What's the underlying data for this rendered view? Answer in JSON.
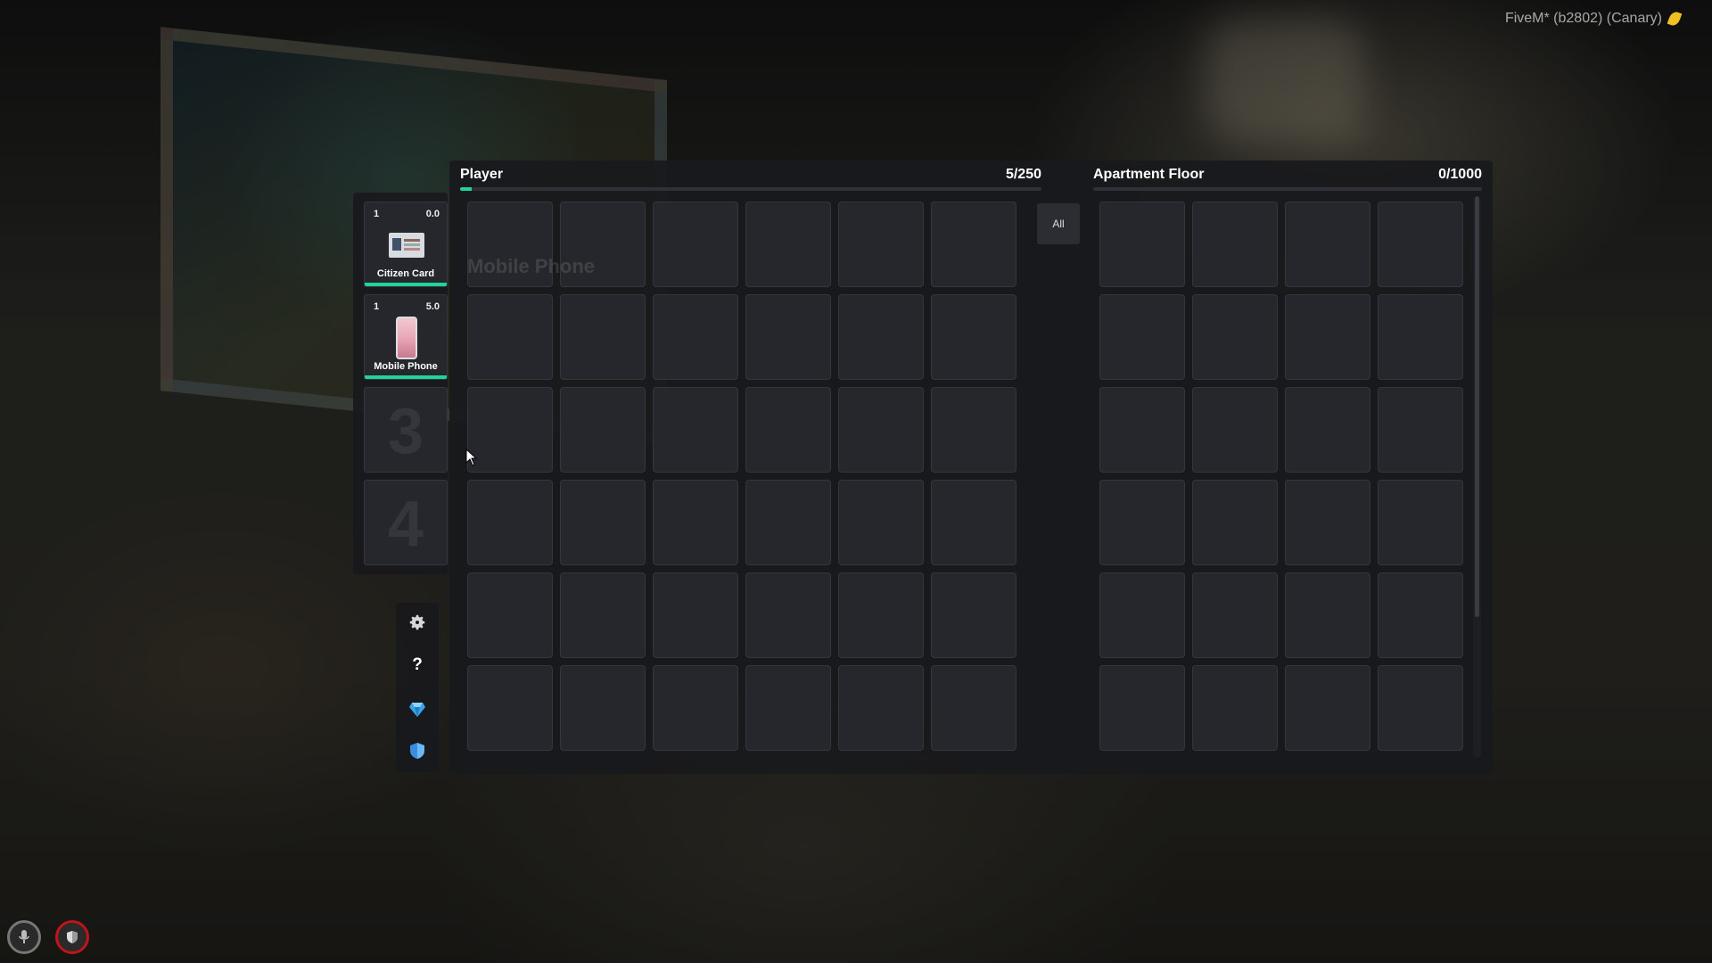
{
  "watermark": {
    "text": "FiveM* (b2802) (Canary)",
    "icon": "lime-leaf-icon"
  },
  "hotbar": {
    "slots": [
      {
        "count": "1",
        "weight": "0.0",
        "label": "Citizen Card",
        "durability": 1.0
      },
      {
        "count": "1",
        "weight": "5.0",
        "label": "Mobile Phone",
        "durability": 1.0
      },
      {
        "number": "3"
      },
      {
        "number": "4"
      }
    ]
  },
  "side_buttons": [
    {
      "name": "settings",
      "icon": "gear-icon"
    },
    {
      "name": "help",
      "icon": "question-icon",
      "text": "?"
    },
    {
      "name": "diamond",
      "icon": "diamond-icon"
    },
    {
      "name": "shield",
      "icon": "shield-icon"
    }
  ],
  "player": {
    "title": "Player",
    "weight": "5/250",
    "fill": 0.02,
    "ghost_text": "Mobile Phone",
    "rows": 6,
    "cols": 6
  },
  "filter": {
    "label": "All"
  },
  "secondary": {
    "title": "Apartment Floor",
    "weight": "0/1000",
    "fill": 0.0,
    "rows": 6,
    "cols": 4
  },
  "hud": {
    "mic": "microphone-icon",
    "armor": "armor-shield-icon"
  },
  "colors": {
    "accent": "#21d39b",
    "panel": "#18191d",
    "slot": "#26272c",
    "armor_ring": "#c0141b"
  }
}
